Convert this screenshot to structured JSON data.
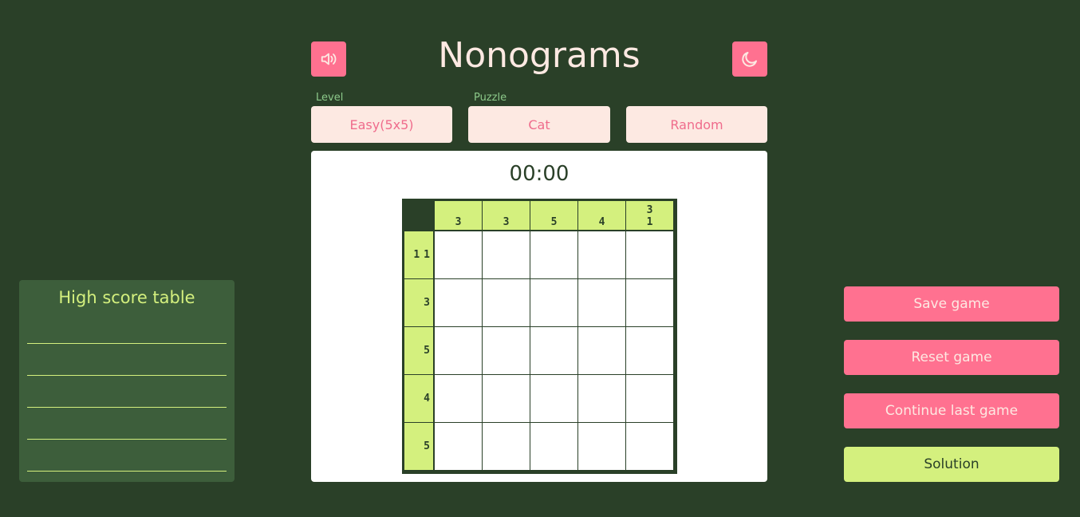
{
  "header": {
    "title": "Nonograms",
    "sound_icon": "speaker-icon",
    "theme_icon": "moon-icon"
  },
  "selectors": {
    "level_label": "Level",
    "level_value": "Easy(5x5)",
    "puzzle_label": "Puzzle",
    "puzzle_value": "Cat",
    "random_label": "Random"
  },
  "board": {
    "timer": "00:00",
    "column_clues": [
      [
        "3"
      ],
      [
        "3"
      ],
      [
        "5"
      ],
      [
        "4"
      ],
      [
        "3",
        "1"
      ]
    ],
    "row_clues": [
      [
        "1",
        "1"
      ],
      [
        "3"
      ],
      [
        "5"
      ],
      [
        "4"
      ],
      [
        "5"
      ]
    ],
    "filled_cells": []
  },
  "high_score": {
    "title": "High score table",
    "entries": [
      "",
      "",
      "",
      "",
      ""
    ]
  },
  "actions": {
    "save": "Save game",
    "reset": "Reset game",
    "continue": "Continue last game",
    "solution": "Solution"
  },
  "colors": {
    "background": "#2a4028",
    "accent_pink": "#ff7190",
    "accent_green": "#d4f07e",
    "cream": "#fde9e2"
  }
}
